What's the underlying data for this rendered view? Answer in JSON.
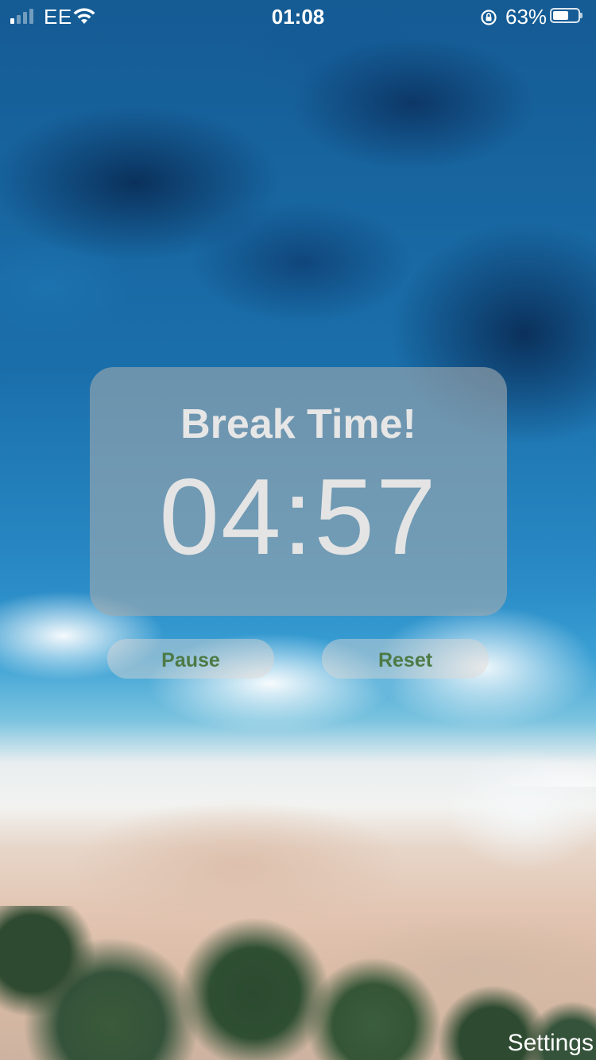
{
  "status_bar": {
    "carrier": "EE",
    "time": "01:08",
    "battery_percent": "63%",
    "battery_level": 0.63,
    "signal_bars_active": 1,
    "signal_bars_total": 4,
    "icons": [
      "signal-icon",
      "wifi-icon",
      "rotation-lock-icon",
      "battery-icon"
    ]
  },
  "timer": {
    "title": "Break Time!",
    "time_remaining": "04:57"
  },
  "controls": {
    "pause_label": "Pause",
    "reset_label": "Reset"
  },
  "footer": {
    "settings_label": "Settings"
  },
  "colors": {
    "button_text": "#4d7a45",
    "card_text": "#e6e6e6",
    "status_text": "#ffffff"
  }
}
